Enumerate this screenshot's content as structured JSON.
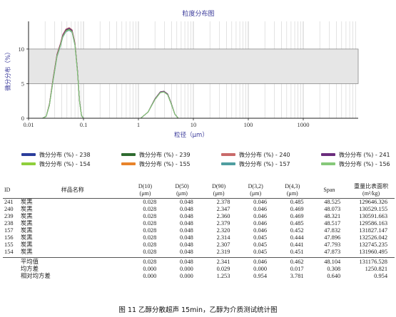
{
  "chart_data": {
    "type": "line",
    "title": "粒度分布图",
    "xlabel": "粒径（μm）",
    "ylabel": "微分分布（%）",
    "xscale": "log",
    "xlim": [
      0.01,
      10000
    ],
    "ylim": [
      0,
      14
    ],
    "xticks": [
      0.01,
      0.1,
      1,
      10,
      100,
      1000
    ],
    "xticklabels": [
      "0.01",
      "0.1",
      "1",
      "10",
      "100",
      "1000"
    ],
    "yticks": [
      0,
      5,
      10
    ],
    "yticklabels": [
      "0",
      "5",
      "10"
    ],
    "shaded_band": [
      5,
      10
    ],
    "grid": "vertical minor lines",
    "series": [
      {
        "name": "微分分布 (%) - 238",
        "color": "#2b3d9b",
        "x": [
          0.018,
          0.021,
          0.024,
          0.028,
          0.033,
          0.038,
          0.042,
          0.048,
          0.055,
          0.062,
          0.07,
          0.078,
          0.085,
          0.092,
          0.1,
          1.1,
          1.5,
          2.0,
          2.5,
          2.9,
          3.4,
          3.9,
          4.6,
          5.3
        ],
        "y": [
          0,
          0.3,
          2.0,
          5.7,
          9.2,
          10.7,
          12.0,
          12.8,
          13.0,
          12.7,
          10.8,
          6.8,
          2.4,
          0.4,
          0,
          0,
          0.9,
          2.8,
          3.8,
          3.9,
          3.5,
          2.3,
          0.6,
          0
        ]
      },
      {
        "name": "微分分布 (%) - 239",
        "color": "#2e6b30",
        "x": [
          0.018,
          0.021,
          0.024,
          0.028,
          0.033,
          0.038,
          0.042,
          0.048,
          0.055,
          0.062,
          0.07,
          0.078,
          0.085,
          0.092,
          0.1,
          1.1,
          1.5,
          2.0,
          2.5,
          2.9,
          3.4,
          3.9,
          4.6,
          5.3
        ],
        "y": [
          0,
          0.3,
          2.0,
          5.6,
          9.1,
          10.6,
          11.9,
          12.7,
          12.9,
          12.6,
          10.7,
          6.7,
          2.4,
          0.4,
          0,
          0,
          0.9,
          2.8,
          3.8,
          3.9,
          3.5,
          2.3,
          0.6,
          0
        ]
      },
      {
        "name": "微分分布 (%) - 240",
        "color": "#c96a6a",
        "x": [
          0.018,
          0.021,
          0.024,
          0.028,
          0.033,
          0.038,
          0.042,
          0.048,
          0.055,
          0.062,
          0.07,
          0.078,
          0.085,
          0.092,
          0.1,
          1.1,
          1.5,
          2.0,
          2.5,
          2.9,
          3.4,
          3.9,
          4.6,
          5.3
        ],
        "y": [
          0,
          0.3,
          2.1,
          5.8,
          9.3,
          10.8,
          12.1,
          12.9,
          13.1,
          12.8,
          10.9,
          6.8,
          2.4,
          0.4,
          0,
          0,
          0.9,
          2.8,
          3.8,
          3.9,
          3.5,
          2.3,
          0.6,
          0
        ]
      },
      {
        "name": "微分分布 (%) - 241",
        "color": "#6b2d7d",
        "x": [
          0.018,
          0.021,
          0.024,
          0.028,
          0.033,
          0.038,
          0.042,
          0.048,
          0.055,
          0.062,
          0.07,
          0.078,
          0.085,
          0.092,
          0.1,
          1.1,
          1.5,
          2.0,
          2.5,
          2.9,
          3.4,
          3.9,
          4.6,
          5.3
        ],
        "y": [
          0,
          0.3,
          2.0,
          5.7,
          9.2,
          10.7,
          12.0,
          12.8,
          13.0,
          12.7,
          10.8,
          6.8,
          2.4,
          0.4,
          0,
          0,
          0.9,
          2.8,
          3.8,
          3.9,
          3.5,
          2.3,
          0.6,
          0
        ]
      },
      {
        "name": "微分分布 (%) - 154",
        "color": "#8fcf3c",
        "x": [
          0.018,
          0.021,
          0.024,
          0.028,
          0.033,
          0.038,
          0.042,
          0.048,
          0.055,
          0.062,
          0.07,
          0.078,
          0.085,
          0.092,
          0.1,
          1.1,
          1.5,
          2.0,
          2.5,
          2.9,
          3.4,
          3.9,
          4.6,
          5.3
        ],
        "y": [
          0,
          0.3,
          1.9,
          5.5,
          9.0,
          10.5,
          11.8,
          12.6,
          12.8,
          12.5,
          10.6,
          6.6,
          2.3,
          0.4,
          0,
          0,
          0.9,
          2.7,
          3.7,
          3.8,
          3.4,
          2.2,
          0.6,
          0
        ]
      },
      {
        "name": "微分分布 (%) - 155",
        "color": "#e8832a",
        "x": [
          0.018,
          0.021,
          0.024,
          0.028,
          0.033,
          0.038,
          0.042,
          0.048,
          0.055,
          0.062,
          0.07,
          0.078,
          0.085,
          0.092,
          0.1,
          1.1,
          1.5,
          2.0,
          2.5,
          2.9,
          3.4,
          3.9,
          4.6,
          5.3
        ],
        "y": [
          0,
          0.3,
          1.9,
          5.5,
          9.0,
          10.5,
          11.8,
          12.6,
          12.8,
          12.5,
          10.6,
          6.6,
          2.3,
          0.4,
          0,
          0,
          0.9,
          2.7,
          3.7,
          3.8,
          3.4,
          2.2,
          0.6,
          0
        ]
      },
      {
        "name": "微分分布 (%) - 157",
        "color": "#4f9ea0",
        "x": [
          0.018,
          0.021,
          0.024,
          0.028,
          0.033,
          0.038,
          0.042,
          0.048,
          0.055,
          0.062,
          0.07,
          0.078,
          0.085,
          0.092,
          0.1,
          1.1,
          1.5,
          2.0,
          2.5,
          2.9,
          3.4,
          3.9,
          4.6,
          5.3
        ],
        "y": [
          0,
          0.3,
          1.9,
          5.4,
          8.9,
          10.4,
          11.7,
          12.5,
          12.7,
          12.4,
          10.5,
          6.6,
          2.3,
          0.4,
          0,
          0,
          0.9,
          2.7,
          3.7,
          3.8,
          3.4,
          2.2,
          0.6,
          0
        ]
      },
      {
        "name": "微分分布 (%) - 156",
        "color": "#86c87a",
        "x": [
          0.018,
          0.021,
          0.024,
          0.028,
          0.033,
          0.038,
          0.042,
          0.048,
          0.055,
          0.062,
          0.07,
          0.078,
          0.085,
          0.092,
          0.1,
          1.1,
          1.5,
          2.0,
          2.5,
          2.9,
          3.4,
          3.9,
          4.6,
          5.3
        ],
        "y": [
          0,
          0.3,
          1.9,
          5.5,
          9.0,
          10.5,
          11.8,
          12.6,
          12.8,
          12.5,
          10.6,
          6.6,
          2.3,
          0.4,
          0,
          0,
          0.9,
          2.7,
          3.7,
          3.8,
          3.4,
          2.2,
          0.6,
          0
        ]
      }
    ]
  },
  "table": {
    "headers": {
      "id": "ID",
      "name": "样品名称",
      "d10": [
        "D(10)",
        "(μm)"
      ],
      "d50": [
        "D(50)",
        "(μm)"
      ],
      "d90": [
        "D(90)",
        "(μm)"
      ],
      "d32": [
        "D(3,2)",
        "(μm)"
      ],
      "d43": [
        "D(4,3)",
        "(μm)"
      ],
      "span": "Span",
      "ssa": [
        "重量比表面积",
        "(m²/kg)"
      ]
    },
    "rows": [
      [
        "241",
        "炭黑",
        "0.028",
        "0.048",
        "2.378",
        "0.046",
        "0.485",
        "48.525",
        "129646.326"
      ],
      [
        "240",
        "炭黑",
        "0.028",
        "0.048",
        "2.347",
        "0.046",
        "0.469",
        "48.073",
        "130529.155"
      ],
      [
        "239",
        "炭黑",
        "0.028",
        "0.048",
        "2.360",
        "0.046",
        "0.469",
        "48.321",
        "130591.663"
      ],
      [
        "238",
        "炭黑",
        "0.028",
        "0.048",
        "2.379",
        "0.046",
        "0.485",
        "48.517",
        "129586.163"
      ],
      [
        "157",
        "炭黑",
        "0.028",
        "0.048",
        "2.320",
        "0.046",
        "0.452",
        "47.832",
        "131827.147"
      ],
      [
        "156",
        "炭黑",
        "0.028",
        "0.048",
        "2.314",
        "0.045",
        "0.444",
        "47.896",
        "132526.042"
      ],
      [
        "155",
        "炭黑",
        "0.028",
        "0.048",
        "2.307",
        "0.045",
        "0.441",
        "47.793",
        "132745.235"
      ],
      [
        "154",
        "炭黑",
        "0.028",
        "0.048",
        "2.319",
        "0.045",
        "0.451",
        "47.873",
        "131960.495"
      ]
    ],
    "summary": [
      [
        "",
        "平均值",
        "0.028",
        "0.048",
        "2.341",
        "0.046",
        "0.462",
        "48.104",
        "131176.528"
      ],
      [
        "",
        "均方差",
        "0.000",
        "0.000",
        "0.029",
        "0.000",
        "0.017",
        "0.308",
        "1250.821"
      ],
      [
        "",
        "相对均方差",
        "0.000",
        "0.000",
        "1.253",
        "0.954",
        "3.781",
        "0.640",
        "0.954"
      ]
    ]
  },
  "caption": "图 11   乙醇分散超声 15min，乙醇为介质测试统计图"
}
